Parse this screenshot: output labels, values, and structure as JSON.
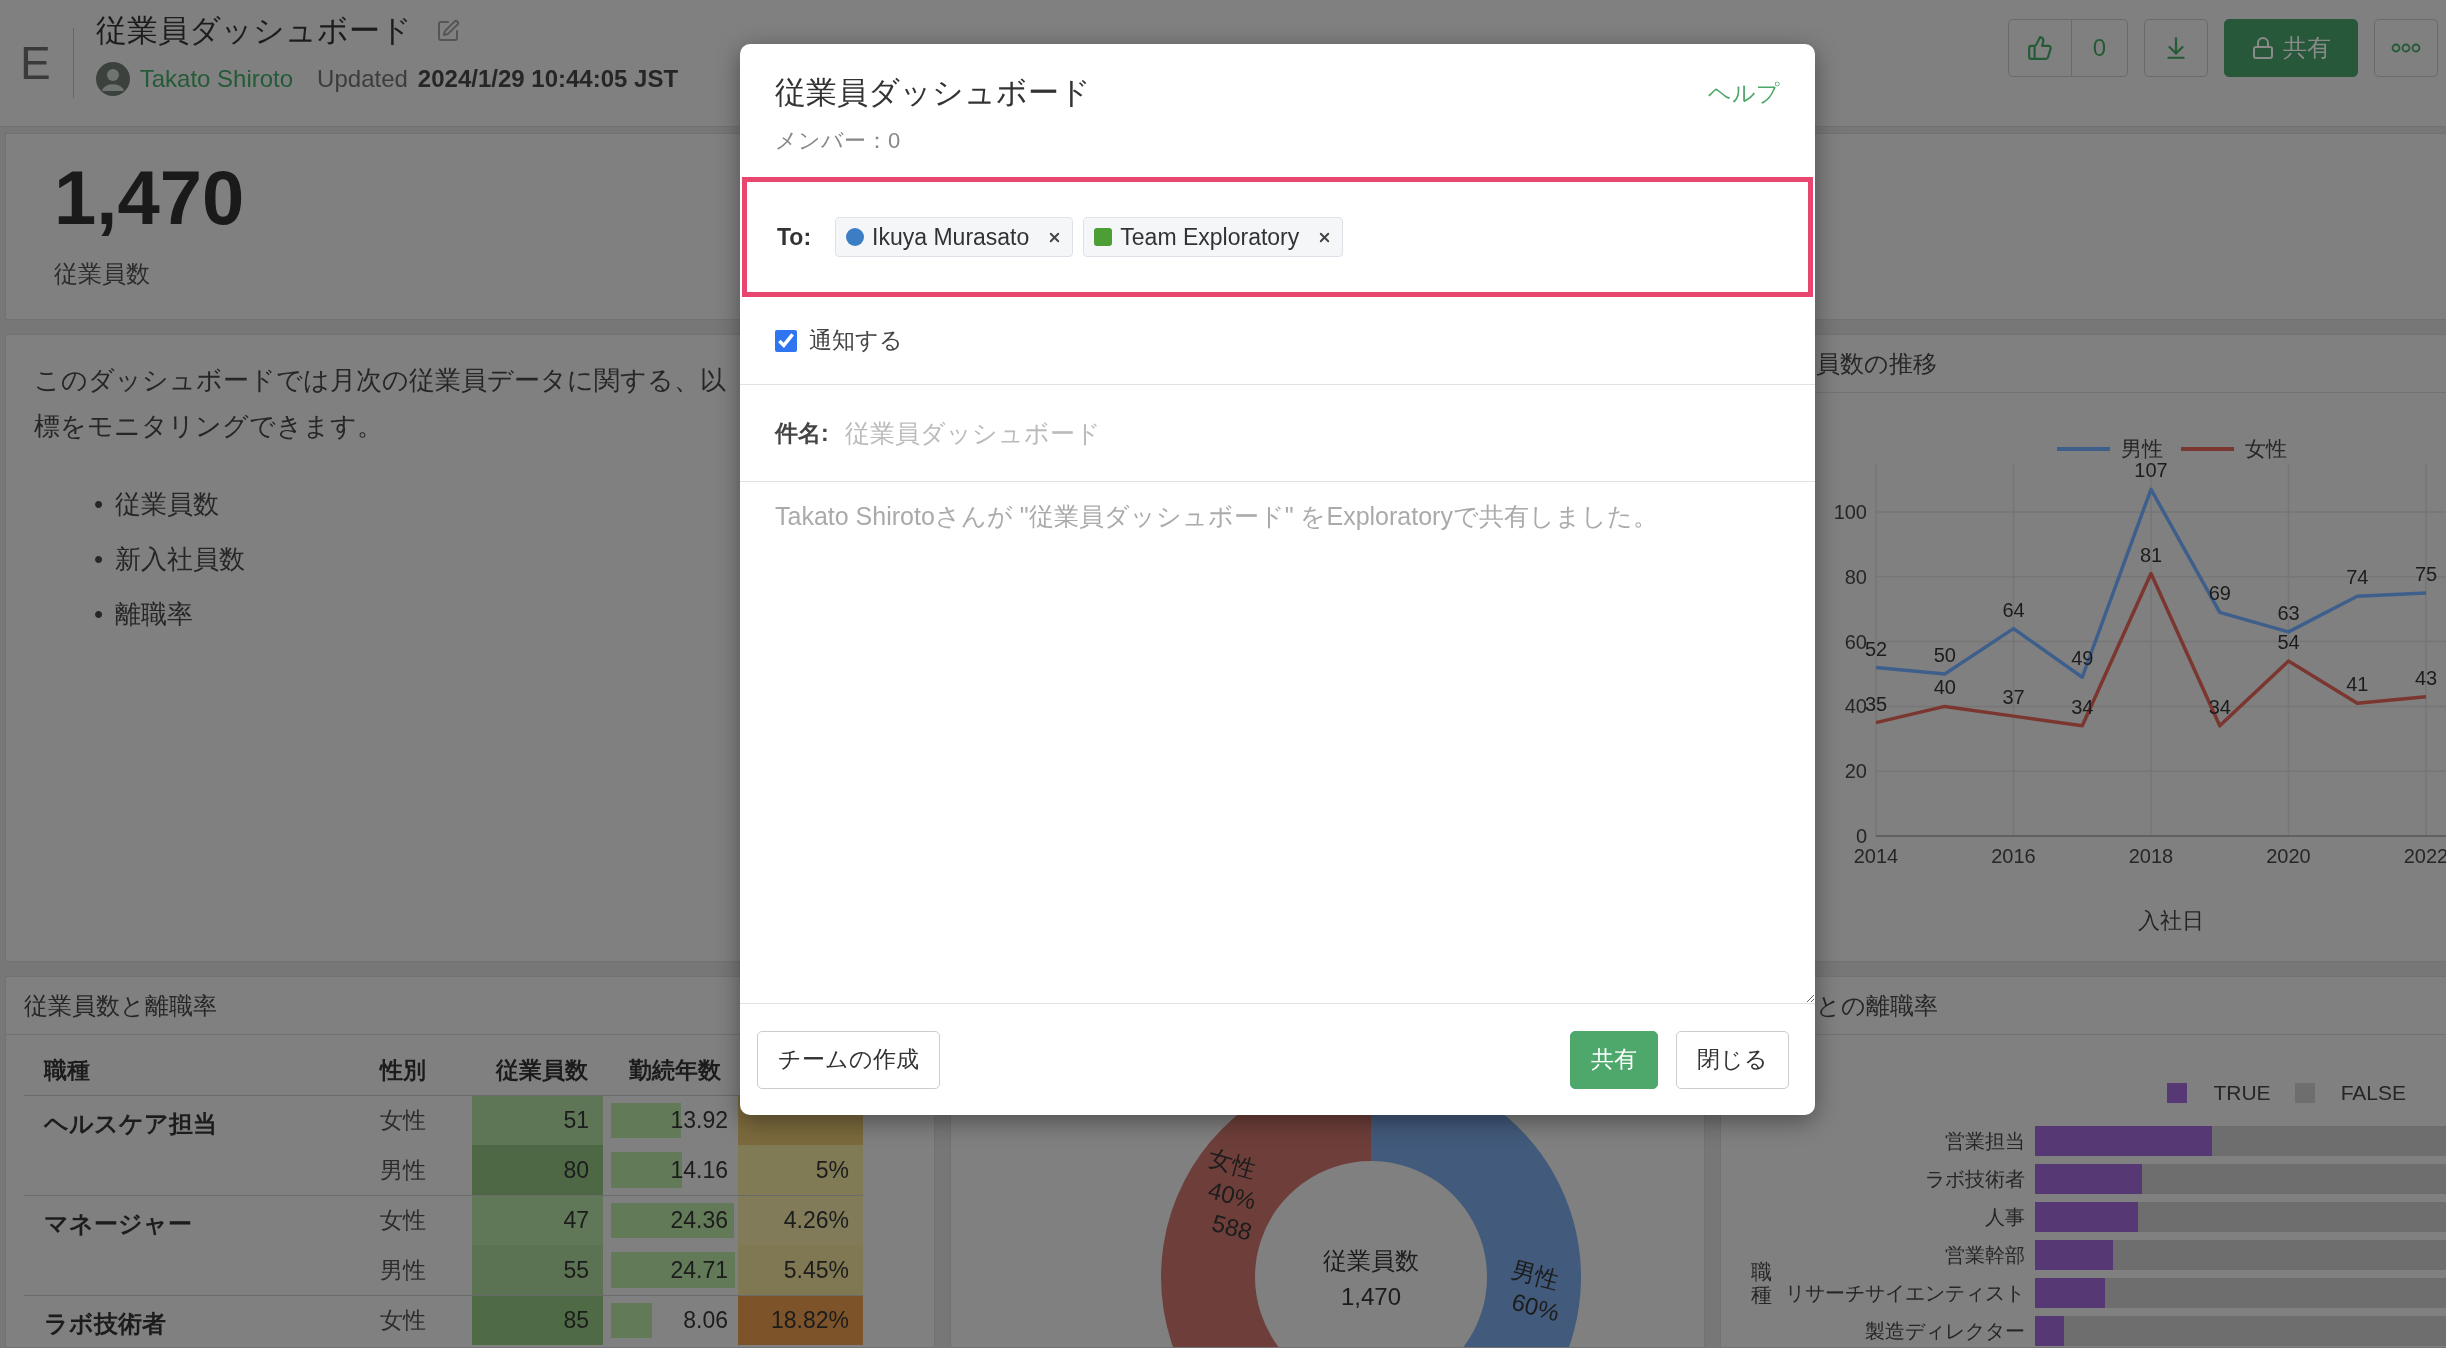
{
  "header": {
    "logo": "E",
    "title": "従業員ダッシュボード",
    "author": "Takato Shiroto",
    "updated_label": "Updated",
    "updated_at": "2024/1/29 10:44:05 JST",
    "like_count": "0",
    "share_button": "共有"
  },
  "kpi": {
    "value": "1,470",
    "label": "従業員数"
  },
  "description": {
    "lines": [
      "このダッシュボードでは月次の従業員データに関する、以",
      "標をモニタリングできます。"
    ],
    "bullets": [
      {
        "marker": "•",
        "text": "従業員数"
      },
      {
        "marker": "•",
        "text": "新入社員数"
      },
      {
        "marker": "•",
        "text": "離職率"
      }
    ]
  },
  "trend_card": {
    "title": "員数の推移",
    "chart_data": {
      "type": "line",
      "xlabel": "入社日",
      "x": [
        2014,
        2015,
        2016,
        2017,
        2018,
        2019,
        2020,
        2021,
        2022
      ],
      "xlim": [
        2014,
        2022
      ],
      "ylim": [
        0,
        115
      ],
      "xticks": [
        2014,
        2016,
        2018,
        2020,
        2022
      ],
      "yticks": [
        0,
        20,
        40,
        60,
        80,
        100
      ],
      "grid": true,
      "legend": "top",
      "data_labels": true,
      "series": [
        {
          "name": "男性",
          "color": "#3e5f8c",
          "values": [
            52,
            50,
            64,
            49,
            107,
            69,
            63,
            74,
            75
          ]
        },
        {
          "name": "女性",
          "color": "#7b3630",
          "values": [
            35,
            40,
            37,
            34,
            81,
            34,
            54,
            41,
            43
          ]
        }
      ]
    }
  },
  "table_card": {
    "title": "従業員数と離職率",
    "columns": [
      "職種",
      "性別",
      "従業員数",
      "勤続年数"
    ],
    "groups": [
      {
        "role": "ヘルスケア担当",
        "rows": [
          {
            "gender": "女性",
            "count": {
              "text": "51",
              "color": "#5f7656"
            },
            "tenure": {
              "text": "13.92",
              "level": 0.55
            },
            "rate": {
              "color": "#7c6a3e"
            }
          },
          {
            "gender": "男性",
            "count": {
              "text": "80",
              "color": "#4e6846"
            },
            "tenure": {
              "text": "14.16",
              "level": 0.56
            },
            "rate": {
              "text": "5%",
              "color": "#807a55"
            }
          }
        ]
      },
      {
        "role": "マネージャー",
        "rows": [
          {
            "gender": "女性",
            "count": {
              "text": "47",
              "color": "#617858"
            },
            "tenure": {
              "text": "24.36",
              "level": 0.97
            },
            "rate": {
              "text": "4.26%",
              "color": "#817b59"
            }
          },
          {
            "gender": "男性",
            "count": {
              "text": "55",
              "color": "#5b7352"
            },
            "tenure": {
              "text": "24.71",
              "level": 0.98
            },
            "rate": {
              "text": "5.45%",
              "color": "#807852"
            }
          }
        ]
      },
      {
        "role": "ラボ技術者",
        "rows": [
          {
            "gender": "女性",
            "count": {
              "text": "85",
              "color": "#4f6b45"
            },
            "tenure": {
              "text": "8.06",
              "level": 0.32
            },
            "rate": {
              "text": "18.82%",
              "color": "#7d532a"
            }
          }
        ]
      }
    ]
  },
  "donut_card": {
    "center_label": "従業員数",
    "center_value": "1,470",
    "chart_data": {
      "type": "donut",
      "categories": [
        "女性",
        "男性"
      ],
      "values": [
        40,
        60
      ],
      "value_labels": [
        "40%",
        "60%"
      ]
    },
    "slices": [
      {
        "count": "588",
        "color": "#6e3f3a"
      },
      {
        "color": "#425a7b"
      }
    ]
  },
  "rate_card": {
    "title": "との離職率",
    "axis_label": "職種",
    "legend": [
      {
        "label": "TRUE",
        "color": "#553874"
      },
      {
        "label": "FALSE",
        "color": "#6e6e6e"
      }
    ],
    "categories": [
      {
        "label": "営業担当",
        "level": 0.43
      },
      {
        "label": "ラボ技術者",
        "level": 0.26
      },
      {
        "label": "人事",
        "level": 0.25
      },
      {
        "label": "営業幹部",
        "level": 0.19
      },
      {
        "label": "リサーチサイエンティスト",
        "level": 0.17
      },
      {
        "label": "製造ディレクター",
        "level": 0.07
      }
    ]
  },
  "modal": {
    "title": "従業員ダッシュボード",
    "members": "メンバー：0",
    "help": "ヘルプ",
    "to_label": "To:",
    "recipients": [
      {
        "kind": "user",
        "name": "Ikuya Murasato",
        "color": "#3b7ec6"
      },
      {
        "kind": "team",
        "name": "Team Exploratory",
        "color": "#4e9e36"
      }
    ],
    "notify": {
      "label": "通知する",
      "checked": true
    },
    "subject": {
      "label": "件名:",
      "placeholder": "従業員ダッシュボード"
    },
    "message": {
      "placeholder": "Takato Shirotoさんが \"従業員ダッシュボード\" をExploratoryで共有しました。"
    },
    "buttons": {
      "create_team": "チームの作成",
      "share": "共有",
      "close": "閉じる"
    }
  }
}
